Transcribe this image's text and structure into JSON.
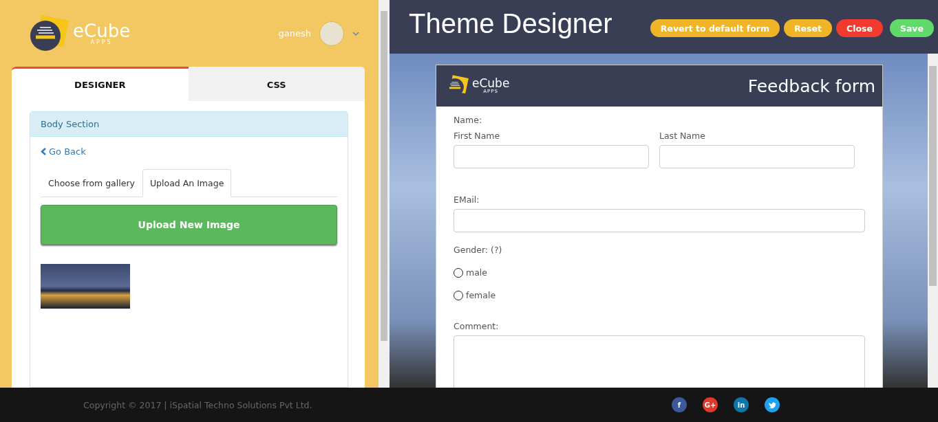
{
  "left_header": {
    "logo": {
      "name": "eCube",
      "sub": "APPS"
    },
    "user": {
      "name": "ganesh"
    }
  },
  "designer_tabs": [
    {
      "label": "DESIGNER",
      "selected": true
    },
    {
      "label": "CSS",
      "selected": false
    }
  ],
  "body_section": {
    "title": "Body Section",
    "back_link": "Go Back",
    "image_tabs": [
      {
        "label": "Choose from gallery",
        "selected": false
      },
      {
        "label": "Upload An Image",
        "selected": true
      }
    ],
    "upload_button": "Upload New Image"
  },
  "right_header": {
    "title": "Theme Designer",
    "buttons": [
      {
        "label": "Revert to default form",
        "color": "#f0b429"
      },
      {
        "label": "Reset",
        "color": "#f0b429"
      },
      {
        "label": "Close",
        "color": "#f23a2f"
      },
      {
        "label": "Save",
        "color": "#62d96b"
      }
    ]
  },
  "form": {
    "logo": {
      "name": "eCube",
      "sub": "APPS"
    },
    "title": "Feedback form",
    "name_label": "Name:",
    "first_name": "First Name",
    "last_name": "Last Name",
    "email_label": "EMail:",
    "gender_label": "Gender: (?)",
    "gender_options": [
      {
        "label": "male",
        "selected": false
      },
      {
        "label": "female",
        "selected": false
      }
    ],
    "comment_label": "Comment:"
  },
  "footer": {
    "copyright": "Copyright © 2017 | iSpatial Techno Solutions Pvt Ltd.",
    "social": [
      {
        "kind": "text",
        "label": "f",
        "color": "#3b5998"
      },
      {
        "kind": "text",
        "label": "G+",
        "color": "#e2382c"
      },
      {
        "kind": "text",
        "label": "in",
        "color": "#0e76a8"
      },
      {
        "kind": "bird",
        "color": "#1da1f2"
      }
    ]
  }
}
